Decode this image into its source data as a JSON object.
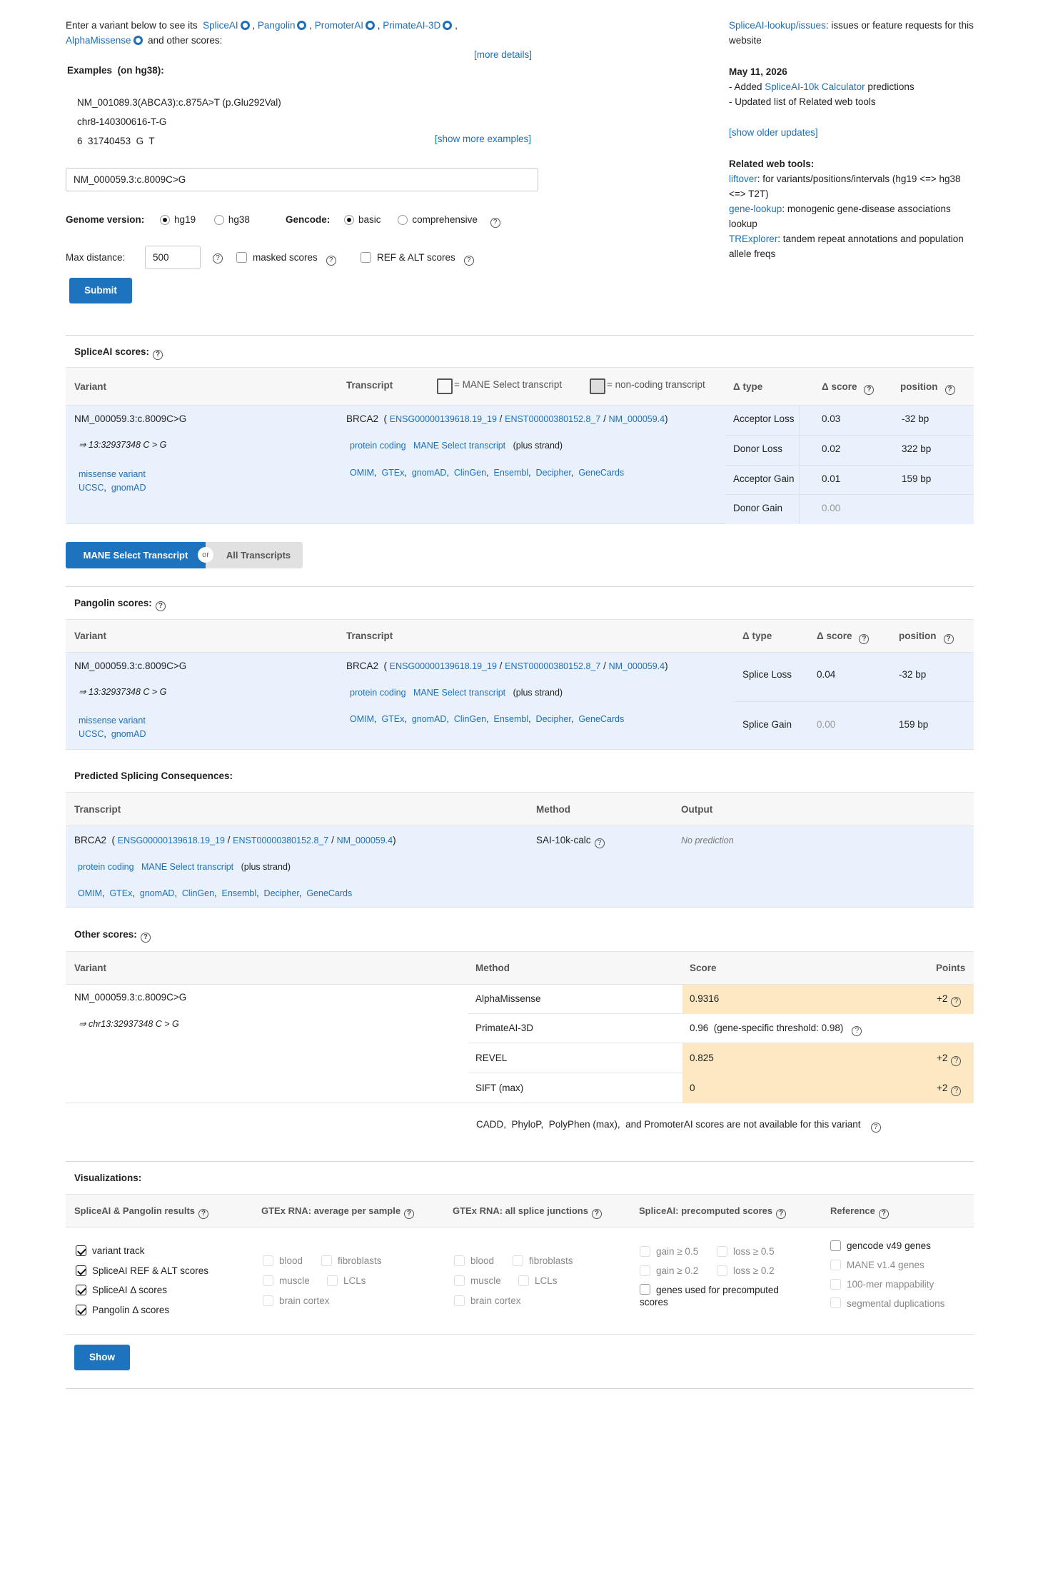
{
  "intro": {
    "prefix": "Enter a variant below to see its",
    "tools": [
      "SpliceAI",
      "Pangolin",
      "PromoterAI",
      "PrimateAI-3D",
      "AlphaMissense"
    ],
    "suffix": "and other scores:",
    "more_details": "[more details]"
  },
  "examples": {
    "title": "Examples",
    "genome": "(on hg38):",
    "items": [
      "NM_001089.3(ABCA3):c.875A>T (p.Glu292Val)",
      "chr8-140300616-T-G",
      "6  31740453  G  T"
    ],
    "show_more": "[show more examples]"
  },
  "form": {
    "variant_value": "NM_000059.3:c.8009C>G",
    "genome_label": "Genome version:",
    "genome_options": [
      "hg19",
      "hg38"
    ],
    "gencode_label": "Gencode:",
    "gencode_options": [
      "basic",
      "comprehensive"
    ],
    "max_distance_label": "Max distance:",
    "max_distance_value": "500",
    "masked_label": "masked scores",
    "refalt_label": "REF & ALT scores",
    "submit": "Submit"
  },
  "side": {
    "issues_link": "SpliceAI-lookup/issues",
    "issues_text": ": issues or feature requests for this website",
    "date": "May 11, 2026",
    "update1_prefix": "- Added ",
    "update1_link": "SpliceAI-10k Calculator",
    "update1_suffix": " predictions",
    "update2": "- Updated list of Related web tools",
    "older": "[show older updates]",
    "related_title": "Related web tools:",
    "tools": [
      {
        "name": "liftover",
        "desc": ": for variants/positions/intervals (hg19 <=> hg38 <=> T2T)"
      },
      {
        "name": "gene-lookup",
        "desc": ": monogenic gene-disease associations lookup"
      },
      {
        "name": "TRExplorer",
        "desc": ": tandem repeat annotations and population allele freqs"
      }
    ]
  },
  "common": {
    "variant": "NM_000059.3:c.8009C>G",
    "pos": "⇒ 13:32937348 C > G",
    "pos_chr": "⇒ chr13:32937348 C > G",
    "consequence": "missense variant",
    "ucsc": "UCSC",
    "gnomad": "gnomAD",
    "gene": "BRCA2",
    "ensg": "ENSG00000139618.19_19",
    "enst": "ENST00000380152.8_7",
    "nm": "NM_000059.4",
    "biotype": "protein coding",
    "mane": "MANE Select transcript",
    "strand": "(plus strand)",
    "links": [
      "OMIM",
      "GTEx",
      "gnomAD",
      "ClinGen",
      "Ensembl",
      "Decipher",
      "GeneCards"
    ]
  },
  "spliceai": {
    "title": "SpliceAI scores:",
    "headers": {
      "variant": "Variant",
      "transcript": "Transcript",
      "mane_legend": "= MANE Select transcript",
      "noncoding_legend": "= non-coding transcript",
      "type": "Δ type",
      "score": "Δ score",
      "position": "position"
    },
    "rows": [
      {
        "type": "Acceptor Loss",
        "score": "0.03",
        "position": "-32 bp"
      },
      {
        "type": "Donor Loss",
        "score": "0.02",
        "position": "322 bp"
      },
      {
        "type": "Acceptor Gain",
        "score": "0.01",
        "position": "159 bp"
      },
      {
        "type": "Donor Gain",
        "score": "0.00",
        "position": ""
      }
    ]
  },
  "toggle": {
    "mane": "MANE Select Transcript",
    "or": "or",
    "all": "All Transcripts"
  },
  "pangolin": {
    "title": "Pangolin scores:",
    "headers": {
      "variant": "Variant",
      "transcript": "Transcript",
      "type": "Δ type",
      "score": "Δ score",
      "position": "position"
    },
    "rows": [
      {
        "type": "Splice Loss",
        "score": "0.04",
        "position": "-32 bp"
      },
      {
        "type": "Splice Gain",
        "score": "0.00",
        "position": "159 bp"
      }
    ]
  },
  "consequences": {
    "title": "Predicted Splicing Consequences:",
    "headers": {
      "transcript": "Transcript",
      "method": "Method",
      "output": "Output"
    },
    "method": "SAI-10k-calc",
    "output": "No prediction"
  },
  "other": {
    "title": "Other scores:",
    "headers": {
      "variant": "Variant",
      "method": "Method",
      "score": "Score",
      "points": "Points"
    },
    "rows": [
      {
        "method": "AlphaMissense",
        "score": "0.9316",
        "points": "+2"
      },
      {
        "method": "PrimateAI-3D",
        "score": "0.96  (gene-specific threshold: 0.98)",
        "points": ""
      },
      {
        "method": "REVEL",
        "score": "0.825",
        "points": "+2"
      },
      {
        "method": "SIFT (max)",
        "score": "0",
        "points": "+2"
      }
    ],
    "note": "CADD,  PhyloP,  PolyPhen (max),  and PromoterAI scores are not available for this variant"
  },
  "viz": {
    "title": "Visualizations:",
    "headers": [
      "SpliceAI & Pangolin results",
      "GTEx RNA: average per sample",
      "GTEx RNA: all splice junctions",
      "SpliceAI: precomputed scores",
      "Reference"
    ],
    "results": [
      "variant track",
      "SpliceAI REF & ALT scores",
      "SpliceAI Δ  scores",
      "Pangolin Δ  scores"
    ],
    "gtex": [
      "blood",
      "fibroblasts",
      "muscle",
      "LCLs",
      "brain cortex"
    ],
    "precomputed": [
      "gain ≥ 0.5",
      "loss ≥ 0.5",
      "gain ≥ 0.2",
      "loss ≥ 0.2",
      "genes used for precomputed scores"
    ],
    "reference": [
      "gencode v49 genes",
      "MANE v1.4 genes",
      "100-mer mappability",
      "segmental duplications"
    ],
    "show": "Show"
  },
  "colors": {
    "accent": "#1e73be",
    "highlight": "#fde8c4",
    "panel": "#e9f1fd"
  }
}
